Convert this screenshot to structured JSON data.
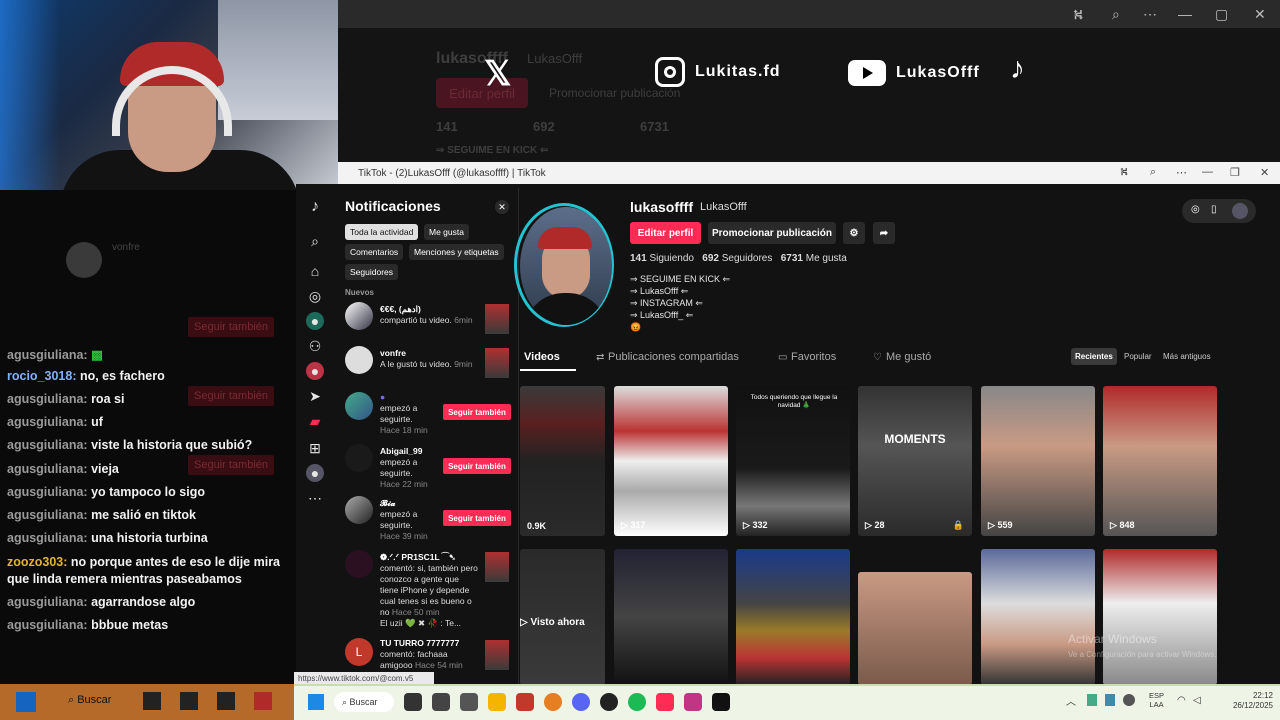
{
  "background_window": {
    "username": "lukasoffff",
    "nickname": "LukasOfff",
    "edit_label": "Editar perfil",
    "promote_label": "Promocionar publicación",
    "stats": [
      "141",
      "692",
      "6731"
    ],
    "bio_line": "⇒ SEGUIME EN KICK ⇐"
  },
  "social_banner": {
    "instagram": "Lukitas.fd",
    "youtube": "LukasOfff"
  },
  "chat": {
    "top_label": "vonfre",
    "follow_back_label": "Seguir también",
    "messages": [
      {
        "user": "agusgiuliana:",
        "text": ""
      },
      {
        "user": "rocio_3018:",
        "text": "no, es fachero"
      },
      {
        "user": "agusgiuliana:",
        "text": "roa si"
      },
      {
        "user": "agusgiuliana:",
        "text": "uf"
      },
      {
        "user": "agusgiuliana:",
        "text": "viste la historia que subió?"
      },
      {
        "user": "agusgiuliana:",
        "text": "vieja"
      },
      {
        "user": "agusgiuliana:",
        "text": "yo tampoco lo sigo"
      },
      {
        "user": "agusgiuliana:",
        "text": "me salió en tiktok"
      },
      {
        "user": "agusgiuliana:",
        "text": "una historia turbina"
      },
      {
        "user": "zoozo303:",
        "text": "no porque antes de eso le dije mira"
      },
      {
        "user": "",
        "text": "que linda remera mientras paseabamos"
      },
      {
        "user": "agusgiuliana:",
        "text": "agarrandose algo"
      },
      {
        "user": "agusgiuliana:",
        "text": "bbbue metas"
      }
    ]
  },
  "tiktok_window": {
    "title": "TikTok - (2)LukasOfff (@lukasoffff) | TikTok",
    "status_url": "https://www.tiktok.com/@com.v5"
  },
  "notifications": {
    "title": "Notificaciones",
    "filters": [
      "Toda la actividad",
      "Me gusta",
      "Comentarios",
      "Menciones y etiquetas",
      "Seguidores"
    ],
    "section": "Nuevos",
    "items": [
      {
        "name": "€€€, (ادهم)",
        "text": "compartió tu video.",
        "time": "6min"
      },
      {
        "name": "vonfre",
        "text": "A le gustó tu video.",
        "time": "9min"
      },
      {
        "name": "",
        "text": "empezó a seguirte.",
        "time": "Hace 18 min"
      },
      {
        "name": "Abigail_99",
        "text": "empezó a seguirte.",
        "time": "Hace 22 min"
      },
      {
        "name": "𝓑𝓲𝓪",
        "text": "empezó a seguirte.",
        "time": "Hace 39 min"
      },
      {
        "name": "❁.ᐟ.ᐟ PR1SC1L ⁀➷",
        "text": "comentó: si, también pero conozco a gente que tiene iPhone y depende cual tenes si es bueno o no",
        "time": "Hace 50 min",
        "extra": "El uzii 💚 ✖ 🥀 : Te..."
      },
      {
        "name": "TU TURRO 7777777",
        "text": "comentó: fachaaa amigooo",
        "time": "Hace 54 min"
      }
    ],
    "follow_label": "Seguir también"
  },
  "profile": {
    "username": "lukasoffff",
    "nickname": "LukasOfff",
    "edit_label": "Editar perfil",
    "promote_label": "Promocionar publicación",
    "following": "141",
    "following_label": "Siguiendo",
    "followers": "692",
    "followers_label": "Seguidores",
    "likes": "6731",
    "likes_label": "Me gusta",
    "bio": [
      "⇒ SEGUIME EN KICK ⇐",
      "⇒ LukasOfff ⇐",
      "⇒ INSTAGRAM ⇐",
      "⇒ LukasOfff_ ⇐",
      "😡"
    ]
  },
  "tabs": {
    "videos": "Videos",
    "reposts": "Publicaciones compartidas",
    "favorites": "Favoritos",
    "liked": "Me gustó",
    "sort": [
      "Recientes",
      "Popular",
      "Más antiguos"
    ]
  },
  "videos": {
    "row1": [
      "0.9K",
      "317",
      "332",
      "28",
      "559",
      "848"
    ],
    "moments_label": "MOMENTS",
    "christmas_text": "Todos queriendo que llegue la navidad 🎄",
    "visto_ahora": "Visto ahora"
  },
  "watermark": {
    "line1": "Activar Windows",
    "line2": "Ve a Configuración para activar Windows."
  },
  "taskbar": {
    "search_left": "Buscar",
    "search_right": "Buscar",
    "lang": "ESP",
    "lang2": "LAA",
    "time": "22:12",
    "date": "26/12/2025"
  }
}
